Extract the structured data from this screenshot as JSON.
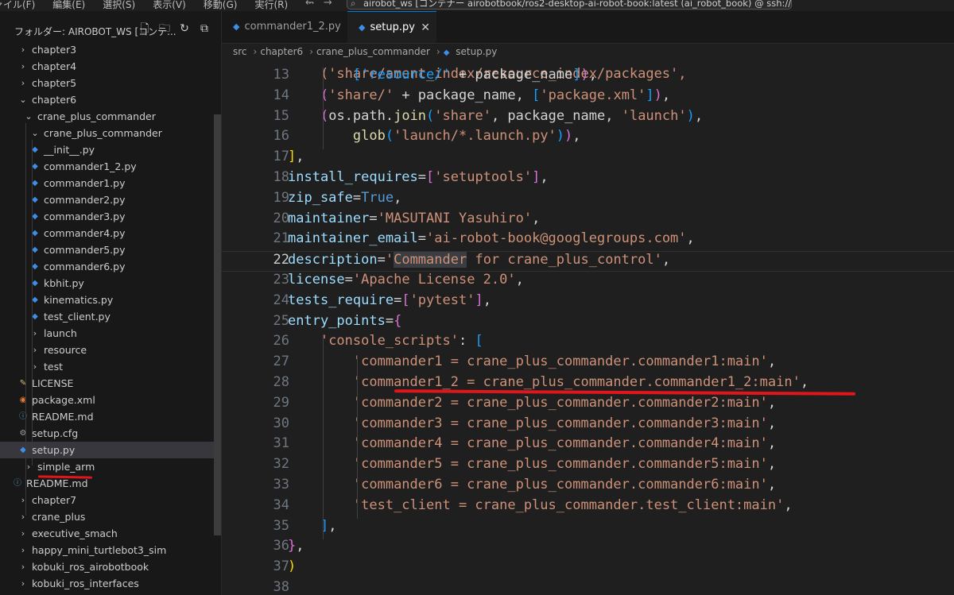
{
  "titlebar": {
    "menu": [
      "ァイル(F)",
      "編集(E)",
      "選択(S)",
      "表示(V)",
      "移動(G)",
      "実行(R)",
      "···"
    ],
    "command_center": "airobot_ws [コンテナー airobotbook/ros2-desktop-ai-robot-book:latest (ai_robot_book) @ ssh://old-ubuntu]"
  },
  "explorer": {
    "title": "フォルダー: AIROBOT_WS [コンテ...",
    "items": [
      {
        "label": "chapter3",
        "type": "folder",
        "expanded": false
      },
      {
        "label": "chapter4",
        "type": "folder",
        "expanded": false
      },
      {
        "label": "chapter5",
        "type": "folder",
        "expanded": false
      },
      {
        "label": "chapter6",
        "type": "folder",
        "expanded": true
      },
      {
        "label": "crane_plus_commander",
        "type": "folder",
        "expanded": true
      },
      {
        "label": "crane_plus_commander",
        "type": "folder",
        "expanded": true
      },
      {
        "label": "__init__.py",
        "type": "python"
      },
      {
        "label": "commander1_2.py",
        "type": "python"
      },
      {
        "label": "commander1.py",
        "type": "python"
      },
      {
        "label": "commander2.py",
        "type": "python"
      },
      {
        "label": "commander3.py",
        "type": "python"
      },
      {
        "label": "commander4.py",
        "type": "python"
      },
      {
        "label": "commander5.py",
        "type": "python"
      },
      {
        "label": "commander6.py",
        "type": "python"
      },
      {
        "label": "kbhit.py",
        "type": "python"
      },
      {
        "label": "kinematics.py",
        "type": "python"
      },
      {
        "label": "test_client.py",
        "type": "python"
      },
      {
        "label": "launch",
        "type": "folder",
        "expanded": false
      },
      {
        "label": "resource",
        "type": "folder",
        "expanded": false
      },
      {
        "label": "test",
        "type": "folder",
        "expanded": false
      },
      {
        "label": "LICENSE",
        "type": "license"
      },
      {
        "label": "package.xml",
        "type": "xml"
      },
      {
        "label": "README.md",
        "type": "info"
      },
      {
        "label": "setup.cfg",
        "type": "config"
      },
      {
        "label": "setup.py",
        "type": "python",
        "selected": true
      },
      {
        "label": "simple_arm",
        "type": "folder",
        "expanded": false
      },
      {
        "label": "README.md",
        "type": "info"
      },
      {
        "label": "chapter7",
        "type": "folder",
        "expanded": false
      },
      {
        "label": "crane_plus",
        "type": "folder",
        "expanded": false
      },
      {
        "label": "executive_smach",
        "type": "folder",
        "expanded": false
      },
      {
        "label": "happy_mini_turtlebot3_sim",
        "type": "folder",
        "expanded": false
      },
      {
        "label": "kobuki_ros_airobotbook",
        "type": "folder",
        "expanded": false
      },
      {
        "label": "kobuki_ros_interfaces",
        "type": "folder",
        "expanded": false
      }
    ]
  },
  "tabs": [
    {
      "label": "commander1_2.py",
      "active": false
    },
    {
      "label": "setup.py",
      "active": true
    }
  ],
  "breadcrumb": [
    "src",
    "chapter6",
    "crane_plus_commander",
    "setup.py"
  ],
  "editor": {
    "current_line": "22",
    "line_numbers": [
      "13",
      "14",
      "15",
      "16",
      "17",
      "18",
      "19",
      "20",
      "21",
      "22",
      "23",
      "24",
      "25",
      "26",
      "27",
      "28",
      "29",
      "30",
      "31",
      "32",
      "33",
      "34",
      "35",
      "36",
      "37",
      "38"
    ],
    "top_partial_line": "    ('share/ament_index/resource_index/packages',",
    "lines": [
      [
        [
          "p",
          "        "
        ],
        [
          "b3",
          "['resource/'"
        ],
        [
          "p",
          " + package_name"
        ],
        [
          "b3",
          "]"
        ],
        [
          "b2",
          ")"
        ],
        [
          "p",
          ","
        ]
      ],
      [
        [
          "p",
          "    "
        ],
        [
          "b2",
          "("
        ],
        [
          "s",
          "'share/'"
        ],
        [
          "p",
          " + package_name, "
        ],
        [
          "b3",
          "["
        ],
        [
          "s",
          "'package.xml'"
        ],
        [
          "b3",
          "]"
        ],
        [
          "b2",
          ")"
        ],
        [
          "p",
          ","
        ]
      ],
      [
        [
          "p",
          "    "
        ],
        [
          "b2",
          "("
        ],
        [
          "p",
          "os.path."
        ],
        [
          "f",
          "join"
        ],
        [
          "b3",
          "("
        ],
        [
          "s",
          "'share'"
        ],
        [
          "p",
          ", package_name, "
        ],
        [
          "s",
          "'launch'"
        ],
        [
          "b3",
          ")"
        ],
        [
          "p",
          ","
        ]
      ],
      [
        [
          "p",
          "        "
        ],
        [
          "f",
          "glob"
        ],
        [
          "b3",
          "("
        ],
        [
          "s",
          "'launch/*.launch.py'"
        ],
        [
          "b3",
          ")"
        ],
        [
          "b2",
          ")"
        ],
        [
          "p",
          ","
        ]
      ],
      [
        [
          "b1",
          "]"
        ],
        [
          "p",
          ","
        ]
      ],
      [
        [
          "v",
          "install_requires"
        ],
        [
          "p",
          "="
        ],
        [
          "b2",
          "["
        ],
        [
          "s",
          "'setuptools'"
        ],
        [
          "b2",
          "]"
        ],
        [
          "p",
          ","
        ]
      ],
      [
        [
          "v",
          "zip_safe"
        ],
        [
          "p",
          "="
        ],
        [
          "k",
          "True"
        ],
        [
          "p",
          ","
        ]
      ],
      [
        [
          "v",
          "maintainer"
        ],
        [
          "p",
          "="
        ],
        [
          "s",
          "'MASUTANI Yasuhiro'"
        ],
        [
          "p",
          ","
        ]
      ],
      [
        [
          "v",
          "maintainer_email"
        ],
        [
          "p",
          "="
        ],
        [
          "s",
          "'ai-robot-book@googlegroups.com'"
        ],
        [
          "p",
          ","
        ]
      ],
      [
        [
          "v",
          "description"
        ],
        [
          "p",
          "="
        ],
        [
          "s",
          "'"
        ],
        [
          "shl",
          "Commander"
        ],
        [
          "s",
          " for crane_plus_control'"
        ],
        [
          "p",
          ","
        ]
      ],
      [
        [
          "v",
          "license"
        ],
        [
          "p",
          "="
        ],
        [
          "s",
          "'Apache License 2.0'"
        ],
        [
          "p",
          ","
        ]
      ],
      [
        [
          "v",
          "tests_require"
        ],
        [
          "p",
          "="
        ],
        [
          "b2",
          "["
        ],
        [
          "s",
          "'pytest'"
        ],
        [
          "b2",
          "]"
        ],
        [
          "p",
          ","
        ]
      ],
      [
        [
          "v",
          "entry_points"
        ],
        [
          "p",
          "="
        ],
        [
          "b2",
          "{"
        ]
      ],
      [
        [
          "p",
          "    "
        ],
        [
          "s",
          "'console_scripts'"
        ],
        [
          "p",
          ": "
        ],
        [
          "b3",
          "["
        ]
      ],
      [
        [
          "p",
          "        "
        ],
        [
          "s",
          "'commander1 = crane_plus_commander.commander1:main'"
        ],
        [
          "p",
          ","
        ]
      ],
      [
        [
          "p",
          "        "
        ],
        [
          "s",
          "'commander1_2 = crane_plus_commander.commander1_2:main'"
        ],
        [
          "p",
          ","
        ]
      ],
      [
        [
          "p",
          "        "
        ],
        [
          "s",
          "'commander2 = crane_plus_commander.commander2:main'"
        ],
        [
          "p",
          ","
        ]
      ],
      [
        [
          "p",
          "        "
        ],
        [
          "s",
          "'commander3 = crane_plus_commander.commander3:main'"
        ],
        [
          "p",
          ","
        ]
      ],
      [
        [
          "p",
          "        "
        ],
        [
          "s",
          "'commander4 = crane_plus_commander.commander4:main'"
        ],
        [
          "p",
          ","
        ]
      ],
      [
        [
          "p",
          "        "
        ],
        [
          "s",
          "'commander5 = crane_plus_commander.commander5:main'"
        ],
        [
          "p",
          ","
        ]
      ],
      [
        [
          "p",
          "        "
        ],
        [
          "s",
          "'commander6 = crane_plus_commander.commander6:main'"
        ],
        [
          "p",
          ","
        ]
      ],
      [
        [
          "p",
          "        "
        ],
        [
          "s",
          "'test_client = crane_plus_commander.test_client:main'"
        ],
        [
          "p",
          ","
        ]
      ],
      [
        [
          "p",
          "    "
        ],
        [
          "b3",
          "]"
        ],
        [
          "p",
          ","
        ]
      ],
      [
        [
          "b2",
          "}"
        ],
        [
          "p",
          ","
        ]
      ],
      [
        [
          "b1",
          ")"
        ]
      ],
      [
        [
          "p",
          ""
        ]
      ]
    ]
  },
  "colors": {
    "accent": "#0078d4",
    "annotation_red": "#e0161a",
    "string": "#ce9178",
    "keyword": "#569cd6"
  }
}
